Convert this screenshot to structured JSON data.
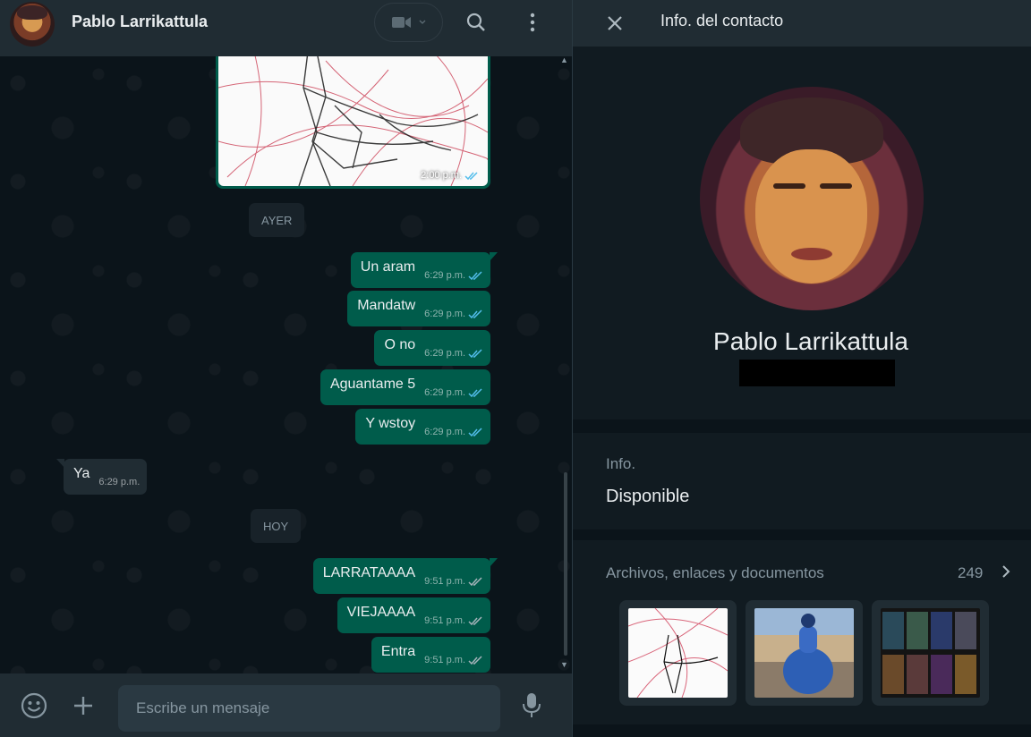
{
  "chat": {
    "contact_name": "Pablo Larrikattula",
    "image_message": {
      "time": "2:00 p.m."
    },
    "days": {
      "yesterday": "AYER",
      "today": "HOY"
    },
    "messages": [
      {
        "text": "Un aram",
        "time": "6:29 p.m.",
        "direction": "out",
        "status": "read"
      },
      {
        "text": "Mandatw",
        "time": "6:29 p.m.",
        "direction": "out",
        "status": "read"
      },
      {
        "text": "O no",
        "time": "6:29 p.m.",
        "direction": "out",
        "status": "read"
      },
      {
        "text": "Aguantame 5",
        "time": "6:29 p.m.",
        "direction": "out",
        "status": "read"
      },
      {
        "text": "Y wstoy",
        "time": "6:29 p.m.",
        "direction": "out",
        "status": "read"
      },
      {
        "text": "Ya",
        "time": "6:29 p.m.",
        "direction": "in"
      },
      {
        "text": "LARRATAAAA",
        "time": "9:51 p.m.",
        "direction": "out",
        "status": "delivered"
      },
      {
        "text": "VIEJAAAA",
        "time": "9:51 p.m.",
        "direction": "out",
        "status": "delivered"
      },
      {
        "text": "Entra",
        "time": "9:51 p.m.",
        "direction": "out",
        "status": "delivered"
      }
    ],
    "composer": {
      "placeholder": "Escribe un mensaje"
    }
  },
  "info": {
    "title": "Info. del contacto",
    "name": "Pablo Larrikattula",
    "about_label": "Info.",
    "about_value": "Disponible",
    "media_label": "Archivos, enlaces y documentos",
    "media_count": "249"
  },
  "colors": {
    "outgoing_bubble": "#005c4b",
    "incoming_bubble": "#202c33",
    "panel": "#111b21",
    "header": "#202c33",
    "read_ticks": "#53bdeb"
  },
  "icons": [
    "video-camera-icon",
    "search-icon",
    "menu-dots-icon",
    "close-icon",
    "emoji-icon",
    "plus-icon",
    "microphone-icon",
    "chevron-right-icon",
    "double-check-icon"
  ]
}
